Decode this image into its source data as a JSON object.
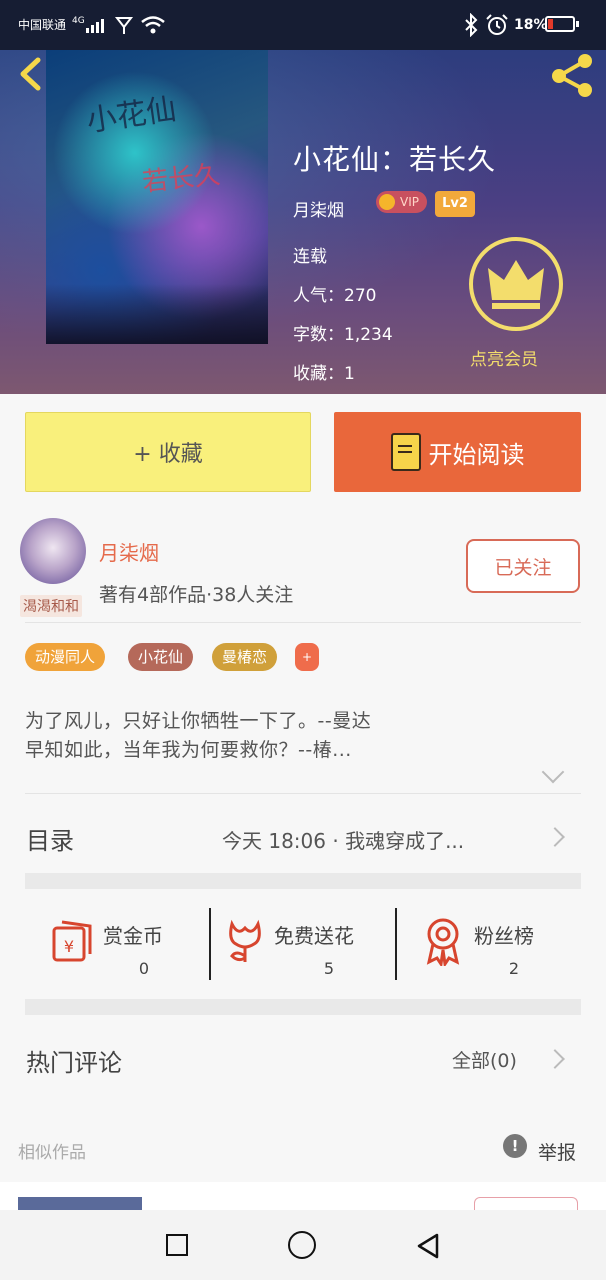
{
  "status_bar": {
    "carrier": "中国联通",
    "network": "4G",
    "battery_percent": "18%",
    "icons": [
      "signal-icon",
      "wifi-icon",
      "bluetooth-icon",
      "alarm-icon",
      "battery-icon"
    ]
  },
  "book": {
    "title": "小花仙：若长久",
    "author": "月柒烟",
    "vip_label": "VIP",
    "level_label": "Lv2",
    "status": "连载",
    "popularity": "人气：270",
    "word_count": "字数：1,234",
    "favorites": "收藏：1",
    "member_label": "点亮会员",
    "cover": {
      "title_art": "小花仙",
      "subtitle_art": "若长久"
    }
  },
  "actions": {
    "favorite_label": "+ 收藏",
    "read_label": "开始阅读"
  },
  "author_card": {
    "name": "月柒烟",
    "avatar_tag": "渴渴和和",
    "stats": "著有4部作品·38人关注",
    "follow_label": "已关注"
  },
  "tags": [
    {
      "label": "动漫同人",
      "color": "#f0a33a"
    },
    {
      "label": "小花仙",
      "color": "#b5695a"
    },
    {
      "label": "曼椿恋",
      "color": "#d0a03a"
    }
  ],
  "tag_more": "+",
  "description": {
    "line1": "为了风儿，只好让你牺牲一下了。--曼达",
    "line2": "早知如此，当年我为何要救你？--椿..."
  },
  "toc": {
    "label": "目录",
    "latest": "今天 18:06 · 我魂穿成了..."
  },
  "stats": [
    {
      "label": "赏金币",
      "value": "0",
      "icon": "reward-coin-icon"
    },
    {
      "label": "免费送花",
      "value": "5",
      "icon": "flower-icon"
    },
    {
      "label": "粉丝榜",
      "value": "2",
      "icon": "medal-icon"
    }
  ],
  "comments": {
    "label": "热门评论",
    "all_label": "全部(0)"
  },
  "similar": {
    "label": "相似作品",
    "report_label": "举报"
  },
  "colors": {
    "accent_orange": "#e9673b",
    "favorite_yellow": "#f9f07c",
    "member_gold": "#f3dd6c",
    "author_red": "#e56a4b"
  }
}
